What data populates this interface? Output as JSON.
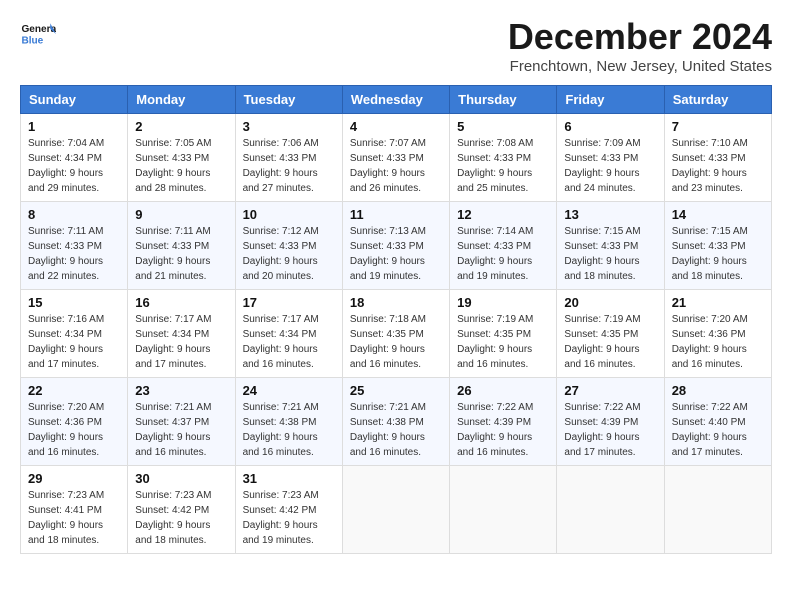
{
  "logo": {
    "line1": "General",
    "line2": "Blue"
  },
  "title": "December 2024",
  "location": "Frenchtown, New Jersey, United States",
  "days_of_week": [
    "Sunday",
    "Monday",
    "Tuesday",
    "Wednesday",
    "Thursday",
    "Friday",
    "Saturday"
  ],
  "weeks": [
    [
      {
        "day": "1",
        "sunrise": "7:04 AM",
        "sunset": "4:34 PM",
        "daylight": "9 hours and 29 minutes."
      },
      {
        "day": "2",
        "sunrise": "7:05 AM",
        "sunset": "4:33 PM",
        "daylight": "9 hours and 28 minutes."
      },
      {
        "day": "3",
        "sunrise": "7:06 AM",
        "sunset": "4:33 PM",
        "daylight": "9 hours and 27 minutes."
      },
      {
        "day": "4",
        "sunrise": "7:07 AM",
        "sunset": "4:33 PM",
        "daylight": "9 hours and 26 minutes."
      },
      {
        "day": "5",
        "sunrise": "7:08 AM",
        "sunset": "4:33 PM",
        "daylight": "9 hours and 25 minutes."
      },
      {
        "day": "6",
        "sunrise": "7:09 AM",
        "sunset": "4:33 PM",
        "daylight": "9 hours and 24 minutes."
      },
      {
        "day": "7",
        "sunrise": "7:10 AM",
        "sunset": "4:33 PM",
        "daylight": "9 hours and 23 minutes."
      }
    ],
    [
      {
        "day": "8",
        "sunrise": "7:11 AM",
        "sunset": "4:33 PM",
        "daylight": "9 hours and 22 minutes."
      },
      {
        "day": "9",
        "sunrise": "7:11 AM",
        "sunset": "4:33 PM",
        "daylight": "9 hours and 21 minutes."
      },
      {
        "day": "10",
        "sunrise": "7:12 AM",
        "sunset": "4:33 PM",
        "daylight": "9 hours and 20 minutes."
      },
      {
        "day": "11",
        "sunrise": "7:13 AM",
        "sunset": "4:33 PM",
        "daylight": "9 hours and 19 minutes."
      },
      {
        "day": "12",
        "sunrise": "7:14 AM",
        "sunset": "4:33 PM",
        "daylight": "9 hours and 19 minutes."
      },
      {
        "day": "13",
        "sunrise": "7:15 AM",
        "sunset": "4:33 PM",
        "daylight": "9 hours and 18 minutes."
      },
      {
        "day": "14",
        "sunrise": "7:15 AM",
        "sunset": "4:33 PM",
        "daylight": "9 hours and 18 minutes."
      }
    ],
    [
      {
        "day": "15",
        "sunrise": "7:16 AM",
        "sunset": "4:34 PM",
        "daylight": "9 hours and 17 minutes."
      },
      {
        "day": "16",
        "sunrise": "7:17 AM",
        "sunset": "4:34 PM",
        "daylight": "9 hours and 17 minutes."
      },
      {
        "day": "17",
        "sunrise": "7:17 AM",
        "sunset": "4:34 PM",
        "daylight": "9 hours and 16 minutes."
      },
      {
        "day": "18",
        "sunrise": "7:18 AM",
        "sunset": "4:35 PM",
        "daylight": "9 hours and 16 minutes."
      },
      {
        "day": "19",
        "sunrise": "7:19 AM",
        "sunset": "4:35 PM",
        "daylight": "9 hours and 16 minutes."
      },
      {
        "day": "20",
        "sunrise": "7:19 AM",
        "sunset": "4:35 PM",
        "daylight": "9 hours and 16 minutes."
      },
      {
        "day": "21",
        "sunrise": "7:20 AM",
        "sunset": "4:36 PM",
        "daylight": "9 hours and 16 minutes."
      }
    ],
    [
      {
        "day": "22",
        "sunrise": "7:20 AM",
        "sunset": "4:36 PM",
        "daylight": "9 hours and 16 minutes."
      },
      {
        "day": "23",
        "sunrise": "7:21 AM",
        "sunset": "4:37 PM",
        "daylight": "9 hours and 16 minutes."
      },
      {
        "day": "24",
        "sunrise": "7:21 AM",
        "sunset": "4:38 PM",
        "daylight": "9 hours and 16 minutes."
      },
      {
        "day": "25",
        "sunrise": "7:21 AM",
        "sunset": "4:38 PM",
        "daylight": "9 hours and 16 minutes."
      },
      {
        "day": "26",
        "sunrise": "7:22 AM",
        "sunset": "4:39 PM",
        "daylight": "9 hours and 16 minutes."
      },
      {
        "day": "27",
        "sunrise": "7:22 AM",
        "sunset": "4:39 PM",
        "daylight": "9 hours and 17 minutes."
      },
      {
        "day": "28",
        "sunrise": "7:22 AM",
        "sunset": "4:40 PM",
        "daylight": "9 hours and 17 minutes."
      }
    ],
    [
      {
        "day": "29",
        "sunrise": "7:23 AM",
        "sunset": "4:41 PM",
        "daylight": "9 hours and 18 minutes."
      },
      {
        "day": "30",
        "sunrise": "7:23 AM",
        "sunset": "4:42 PM",
        "daylight": "9 hours and 18 minutes."
      },
      {
        "day": "31",
        "sunrise": "7:23 AM",
        "sunset": "4:42 PM",
        "daylight": "9 hours and 19 minutes."
      },
      null,
      null,
      null,
      null
    ]
  ]
}
